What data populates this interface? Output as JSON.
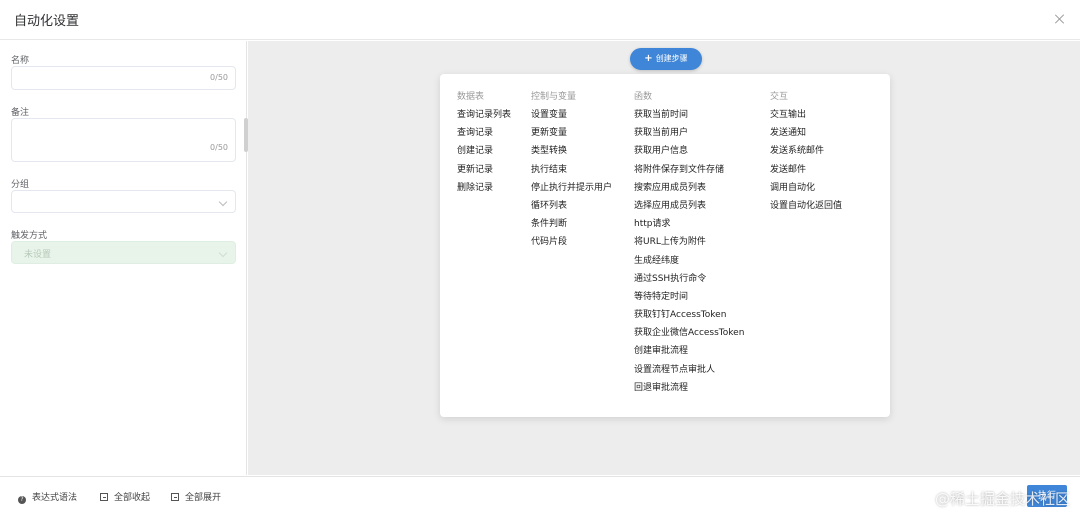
{
  "header": {
    "title": "自动化设置",
    "close_icon": "close-icon"
  },
  "form": {
    "name": {
      "label": "名称",
      "value": "",
      "counter": "0/50"
    },
    "note": {
      "label": "备注",
      "value": "",
      "counter": "0/50"
    },
    "group": {
      "label": "分组",
      "value": ""
    },
    "trigger": {
      "label": "触发方式",
      "placeholder": "未设置"
    }
  },
  "canvas": {
    "create_step_label": "创建步骤",
    "create_icon": "plus-icon",
    "menu": {
      "columns": [
        {
          "title": "数据表",
          "items": [
            "查询记录列表",
            "查询记录",
            "创建记录",
            "更新记录",
            "删除记录"
          ]
        },
        {
          "title": "控制与变量",
          "items": [
            "设置变量",
            "更新变量",
            "类型转换",
            "执行结束",
            "停止执行并提示用户",
            "循环列表",
            "条件判断",
            "代码片段"
          ]
        },
        {
          "title": "函数",
          "items": [
            "获取当前时间",
            "获取当前用户",
            "获取用户信息",
            "将附件保存到文件存储",
            "搜索应用成员列表",
            "选择应用成员列表",
            "http请求",
            "将URL上传为附件",
            "生成经纬度",
            "通过SSH执行命令",
            "等待特定时间",
            "获取钉钉AccessToken",
            "获取企业微信AccessToken",
            "创建审批流程",
            "设置流程节点审批人",
            "回退审批流程"
          ]
        },
        {
          "title": "交互",
          "items": [
            "交互输出",
            "发送通知",
            "发送系统邮件",
            "发送邮件",
            "调用自动化",
            "设置自动化返回值"
          ]
        }
      ]
    }
  },
  "footer": {
    "expr_syntax": "表达式语法",
    "collapse_all": "全部收起",
    "expand_all": "全部展开",
    "run_label": "执行",
    "watermark": "@稀土掘金技术社区"
  },
  "colors": {
    "accent": "#3f86d8",
    "canvas_bg": "#ededed"
  }
}
